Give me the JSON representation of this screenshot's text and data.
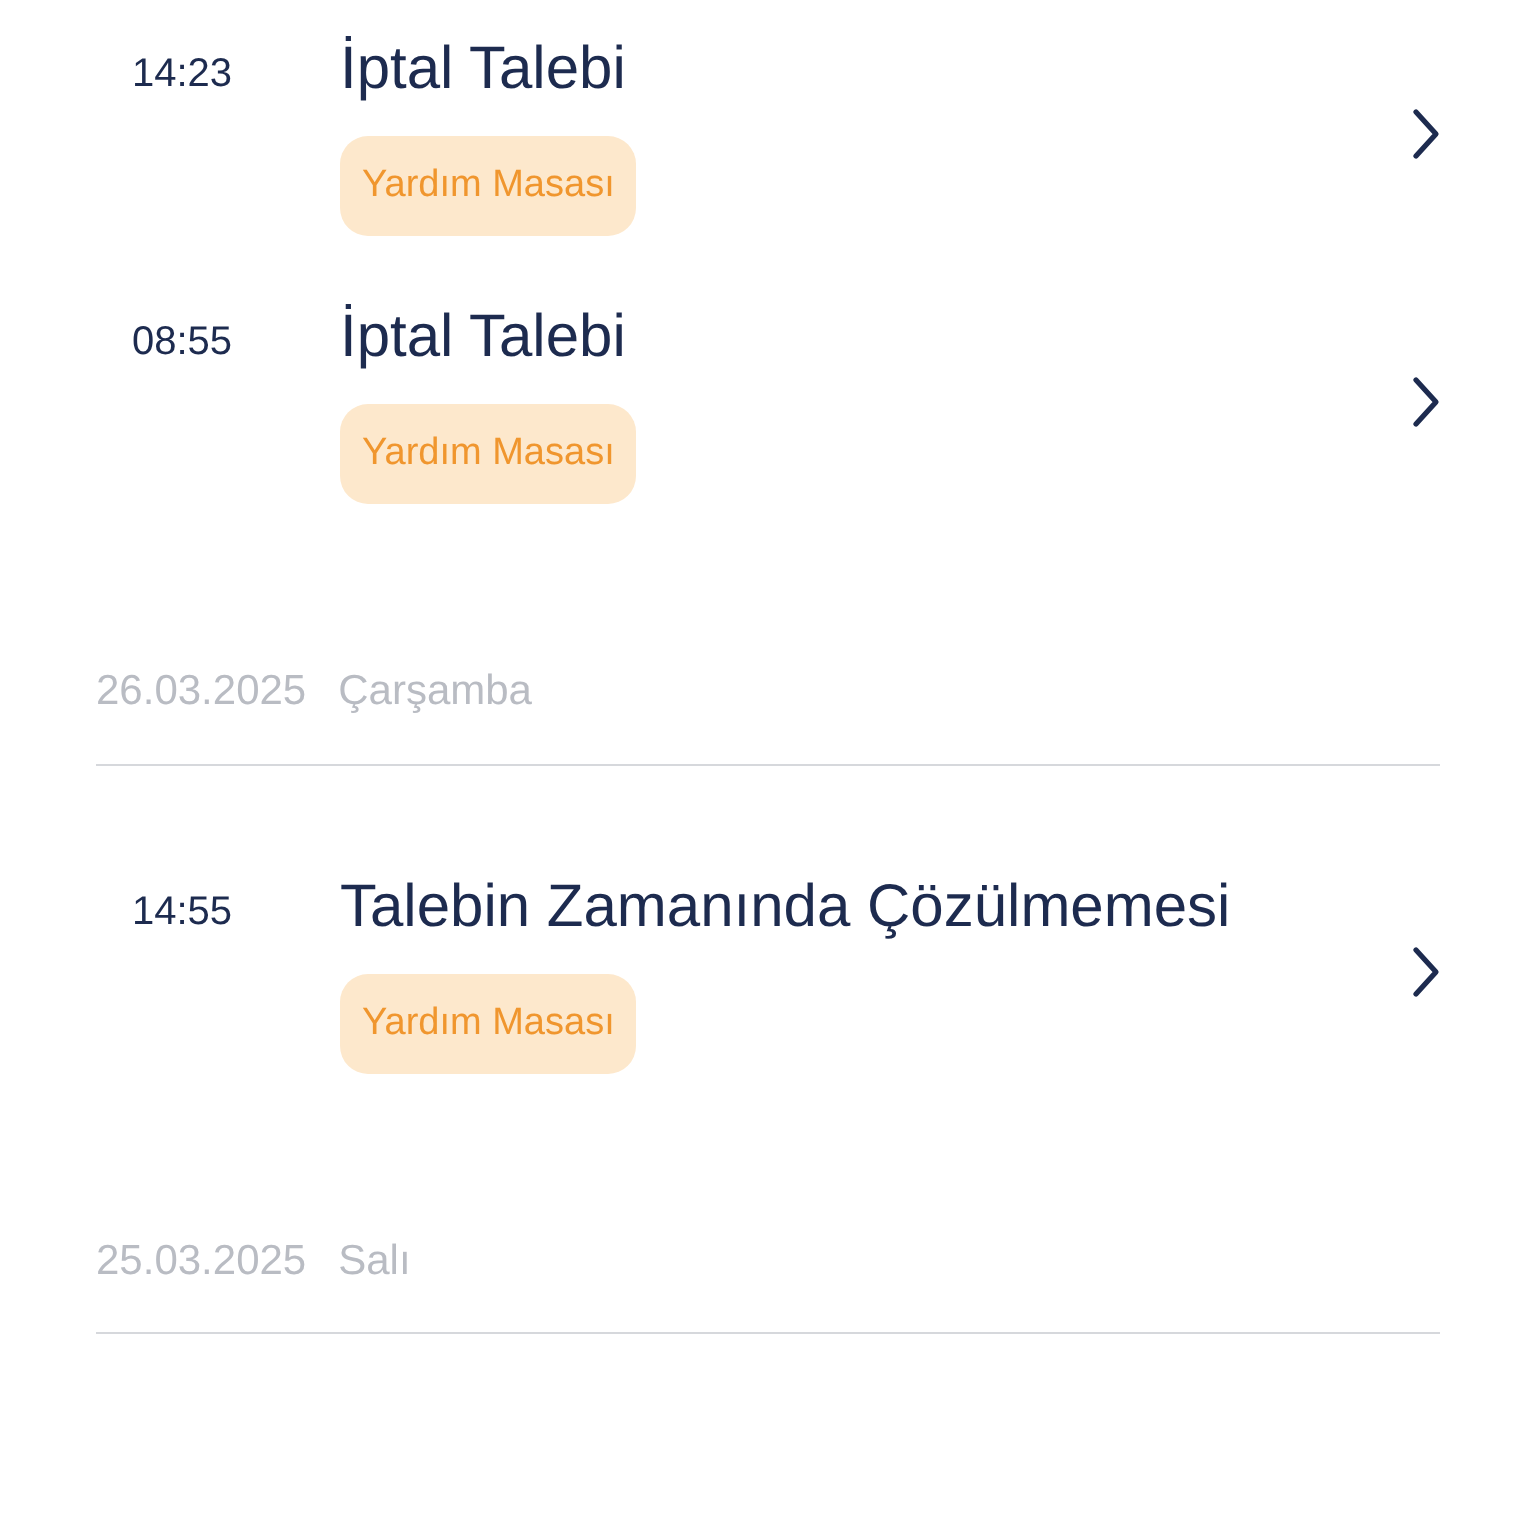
{
  "groups": [
    {
      "items": [
        {
          "time": "14:23",
          "title": "İptal Talebi",
          "tag": "Yardım Masası"
        },
        {
          "time": "08:55",
          "title": "İptal Talebi",
          "tag": "Yardım Masası"
        }
      ]
    },
    {
      "date": "26.03.2025",
      "day": "Çarşamba",
      "items": [
        {
          "time": "14:55",
          "title": "Talebin Zamanında Çözülmemesi",
          "tag": "Yardım Masası"
        }
      ]
    },
    {
      "date": "25.03.2025",
      "day": "Salı"
    }
  ]
}
